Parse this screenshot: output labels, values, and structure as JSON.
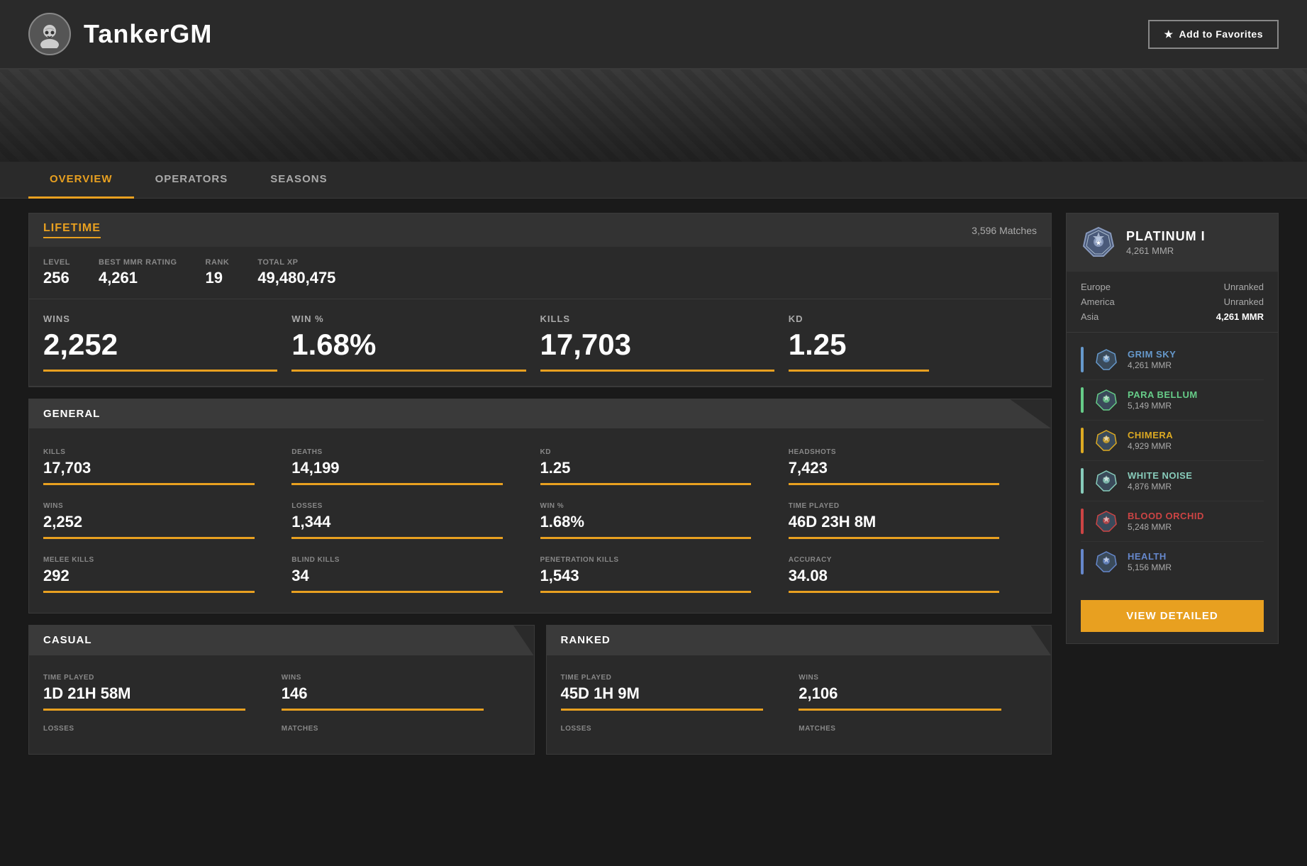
{
  "header": {
    "player_name": "TankerGM",
    "add_favorites_label": "Add to Favorites",
    "star_icon": "★"
  },
  "nav": {
    "tabs": [
      {
        "id": "overview",
        "label": "OVERVIEW",
        "active": true
      },
      {
        "id": "operators",
        "label": "OPERATORS",
        "active": false
      },
      {
        "id": "seasons",
        "label": "SEASONS",
        "active": false
      }
    ]
  },
  "lifetime": {
    "section_title": "LIFETIME",
    "matches_count": "3,596 Matches",
    "level_label": "LEVEL",
    "level_value": "256",
    "best_mmr_label": "BEST MMR RATING",
    "best_mmr_value": "4,261",
    "rank_label": "RANK",
    "rank_value": "19",
    "total_xp_label": "TOTAL XP",
    "total_xp_value": "49,480,475",
    "wins_label": "WINS",
    "wins_value": "2,252",
    "win_pct_label": "WIN %",
    "win_pct_value": "1.68%",
    "kills_label": "KILLS",
    "kills_value": "17,703",
    "kd_label": "KD",
    "kd_value": "1.25"
  },
  "general": {
    "section_title": "GENERAL",
    "stats": [
      {
        "label": "KILLS",
        "value": "17,703"
      },
      {
        "label": "DEATHS",
        "value": "14,199"
      },
      {
        "label": "KD",
        "value": "1.25"
      },
      {
        "label": "HEADSHOTS",
        "value": "7,423"
      },
      {
        "label": "WINS",
        "value": "2,252"
      },
      {
        "label": "LOSSES",
        "value": "1,344"
      },
      {
        "label": "WIN %",
        "value": "1.68%"
      },
      {
        "label": "TIME PLAYED",
        "value": "46D 23H 8M"
      },
      {
        "label": "MELEE KILLS",
        "value": "292"
      },
      {
        "label": "BLIND KILLS",
        "value": "34"
      },
      {
        "label": "PENETRATION KILLS",
        "value": "1,543"
      },
      {
        "label": "ACCURACY",
        "value": "34.08"
      }
    ]
  },
  "casual": {
    "section_title": "CASUAL",
    "stats": [
      {
        "label": "TIME PLAYED",
        "value": "1D 21H 58M"
      },
      {
        "label": "WINS",
        "value": "146"
      },
      {
        "label": "LOSSES",
        "value": ""
      },
      {
        "label": "MATCHES",
        "value": ""
      }
    ]
  },
  "ranked": {
    "section_title": "RANKED",
    "stats": [
      {
        "label": "TIME PLAYED",
        "value": "45D 1H 9M"
      },
      {
        "label": "WINS",
        "value": "2,106"
      },
      {
        "label": "LOSSES",
        "value": ""
      },
      {
        "label": "MATCHES",
        "value": ""
      }
    ]
  },
  "right_panel": {
    "rank_name": "PLATINUM I",
    "rank_mmr": "4,261 MMR",
    "regions": [
      {
        "name": "Europe",
        "value": "Unranked"
      },
      {
        "name": "America",
        "value": "Unranked"
      },
      {
        "name": "Asia",
        "value": "4,261 MMR",
        "highlight": true
      }
    ],
    "seasons": [
      {
        "name": "GRIM SKY",
        "mmr": "4,261 MMR",
        "color": "#6699cc"
      },
      {
        "name": "PARA BELLUM",
        "mmr": "5,149 MMR",
        "color": "#66cc88"
      },
      {
        "name": "CHIMERA",
        "mmr": "4,929 MMR",
        "color": "#ddaa22"
      },
      {
        "name": "WHITE NOISE",
        "mmr": "4,876 MMR",
        "color": "#88ccbb"
      },
      {
        "name": "BLOOD ORCHID",
        "mmr": "5,248 MMR",
        "color": "#cc4444"
      },
      {
        "name": "HEALTH",
        "mmr": "5,156 MMR",
        "color": "#6688cc"
      }
    ],
    "view_detailed_label": "View Detailed"
  }
}
